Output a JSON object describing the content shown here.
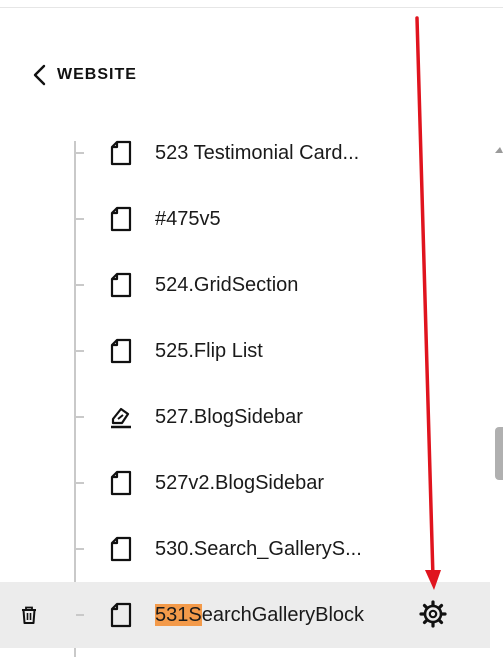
{
  "nav": {
    "back_label": "WEBSITE"
  },
  "tree": {
    "items": [
      {
        "label": "523 Testimonial Card...",
        "icon": "page-icon"
      },
      {
        "label": "#475v5",
        "icon": "page-icon"
      },
      {
        "label": "524.GridSection",
        "icon": "page-icon"
      },
      {
        "label": "525.Flip List",
        "icon": "page-icon"
      },
      {
        "label": "527.BlogSidebar",
        "icon": "edit-page-icon"
      },
      {
        "label": "527v2.BlogSidebar",
        "icon": "page-icon"
      },
      {
        "label": "530.Search_GalleryS...",
        "icon": "page-icon"
      },
      {
        "label_highlight": "531S",
        "label_rest": "earchGalleryBlock",
        "icon": "page-icon",
        "selected": true
      }
    ]
  },
  "colors": {
    "highlight": "#f39a4a",
    "arrow": "#e0141e",
    "selected_row": "#ececec"
  }
}
